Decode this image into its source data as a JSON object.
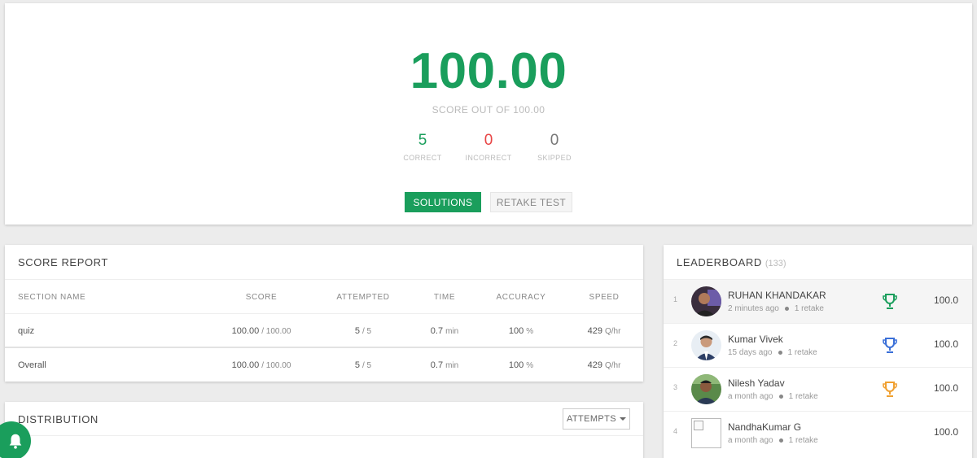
{
  "result": {
    "score": "100.00",
    "score_subtitle": "SCORE OUT OF 100.00",
    "stats": [
      {
        "value": "5",
        "label": "CORRECT",
        "color": "#1a9e5c"
      },
      {
        "value": "0",
        "label": "INCORRECT",
        "color": "#e84545"
      },
      {
        "value": "0",
        "label": "SKIPPED",
        "color": "#777777"
      }
    ],
    "solutions_label": "SOLUTIONS",
    "retake_label": "RETAKE TEST"
  },
  "score_report": {
    "title": "SCORE REPORT",
    "headers": {
      "section": "SECTION NAME",
      "score": "SCORE",
      "attempted": "ATTEMPTED",
      "time": "TIME",
      "accuracy": "ACCURACY",
      "speed": "SPEED"
    },
    "rows": [
      {
        "section": "quiz",
        "score": "100.00",
        "score_total": "/ 100.00",
        "attempted": "5",
        "attempted_total": "/ 5",
        "time": "0.7",
        "time_unit": "min",
        "accuracy": "100",
        "accuracy_unit": "%",
        "speed": "429",
        "speed_unit": "Q/hr"
      },
      {
        "section": "Overall",
        "score": "100.00",
        "score_total": "/ 100.00",
        "attempted": "5",
        "attempted_total": "/ 5",
        "time": "0.7",
        "time_unit": "min",
        "accuracy": "100",
        "accuracy_unit": "%",
        "speed": "429",
        "speed_unit": "Q/hr"
      }
    ]
  },
  "distribution": {
    "title": "DISTRIBUTION",
    "dropdown_label": "ATTEMPTS"
  },
  "leaderboard": {
    "title": "LEADERBOARD",
    "count": "(133)",
    "entries": [
      {
        "rank": "1",
        "name": "RUHAN KHANDAKAR",
        "time": "2 minutes ago",
        "retakes": "1 retake",
        "score": "100.0",
        "trophy": "gold-trophy-green"
      },
      {
        "rank": "2",
        "name": "Kumar Vivek",
        "time": "15 days ago",
        "retakes": "1 retake",
        "score": "100.0",
        "trophy": "silver-trophy-blue"
      },
      {
        "rank": "3",
        "name": "Nilesh Yadav",
        "time": "a month ago",
        "retakes": "1 retake",
        "score": "100.0",
        "trophy": "bronze-trophy-orange"
      },
      {
        "rank": "4",
        "name": "NandhaKumar G",
        "time": "a month ago",
        "retakes": "1 retake",
        "score": "100.0"
      }
    ]
  },
  "colors": {
    "accent": "#1a9e5c",
    "incorrect": "#e84545",
    "trophy_1": "#1a9e5c",
    "trophy_2": "#3a6fd8",
    "trophy_3": "#f0a030"
  },
  "icons": {
    "notification": "bell-icon",
    "dropdown": "caret-down-icon"
  }
}
